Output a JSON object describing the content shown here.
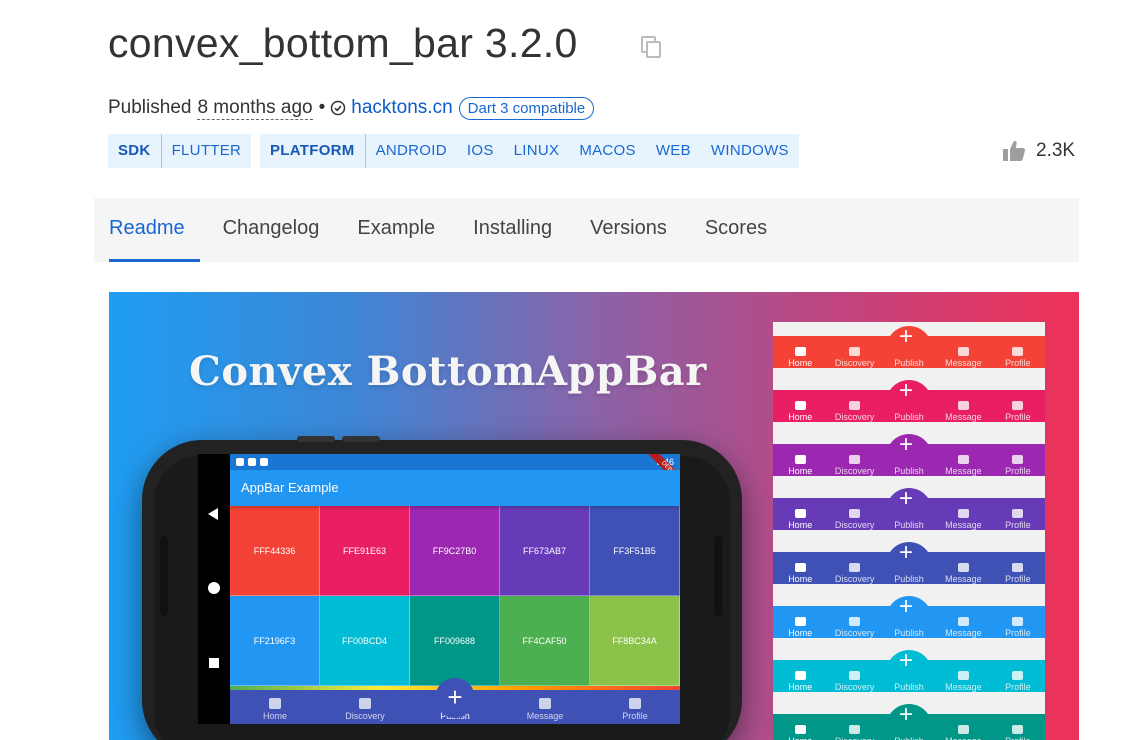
{
  "header": {
    "package_title": "convex_bottom_bar 3.2.0",
    "copy_icon": "copy-icon"
  },
  "meta": {
    "published_label": "Published",
    "published_ago": "8 months ago",
    "separator": "•",
    "verified_icon": "verified-publisher-icon",
    "publisher": "hacktons.cn",
    "dart_badge": "Dart 3 compatible"
  },
  "tags": {
    "sdk": {
      "label": "SDK",
      "items": [
        "FLUTTER"
      ]
    },
    "platform": {
      "label": "PLATFORM",
      "items": [
        "ANDROID",
        "IOS",
        "LINUX",
        "MACOS",
        "WEB",
        "WINDOWS"
      ]
    }
  },
  "likes": {
    "icon": "thumbs-up-icon",
    "count": "2.3K"
  },
  "tabs": [
    {
      "label": "Readme",
      "active": true
    },
    {
      "label": "Changelog"
    },
    {
      "label": "Example"
    },
    {
      "label": "Installing"
    },
    {
      "label": "Versions"
    },
    {
      "label": "Scores"
    }
  ],
  "banner": {
    "title": "Convex BottomAppBar",
    "phone": {
      "time": "3:46",
      "debug_ribbon": "DEBUG",
      "appbar_title": "AppBar Example",
      "grid": [
        {
          "label": "FFF44336",
          "color": "#F44336"
        },
        {
          "label": "FFE91E63",
          "color": "#E91E63"
        },
        {
          "label": "FF9C27B0",
          "color": "#9C27B0"
        },
        {
          "label": "FF673AB7",
          "color": "#673AB7"
        },
        {
          "label": "FF3F51B5",
          "color": "#3F51B5"
        },
        {
          "label": "FF2196F3",
          "color": "#2196F3"
        },
        {
          "label": "FF00BCD4",
          "color": "#00BCD4"
        },
        {
          "label": "FF009688",
          "color": "#009688"
        },
        {
          "label": "FF4CAF50",
          "color": "#4CAF50"
        },
        {
          "label": "FF8BC34A",
          "color": "#8BC34A"
        }
      ],
      "nav_items": [
        "Home",
        "Discovery",
        "Publish",
        "Message",
        "Profile"
      ],
      "active_nav": "Publish"
    },
    "bar_samples": {
      "colors": [
        "#F44336",
        "#E91E63",
        "#9C27B0",
        "#673AB7",
        "#3F51B5",
        "#2196F3",
        "#00BCD4",
        "#009688"
      ],
      "labels": [
        "Home",
        "Discovery",
        "Publish",
        "Message",
        "Profile"
      ]
    }
  }
}
